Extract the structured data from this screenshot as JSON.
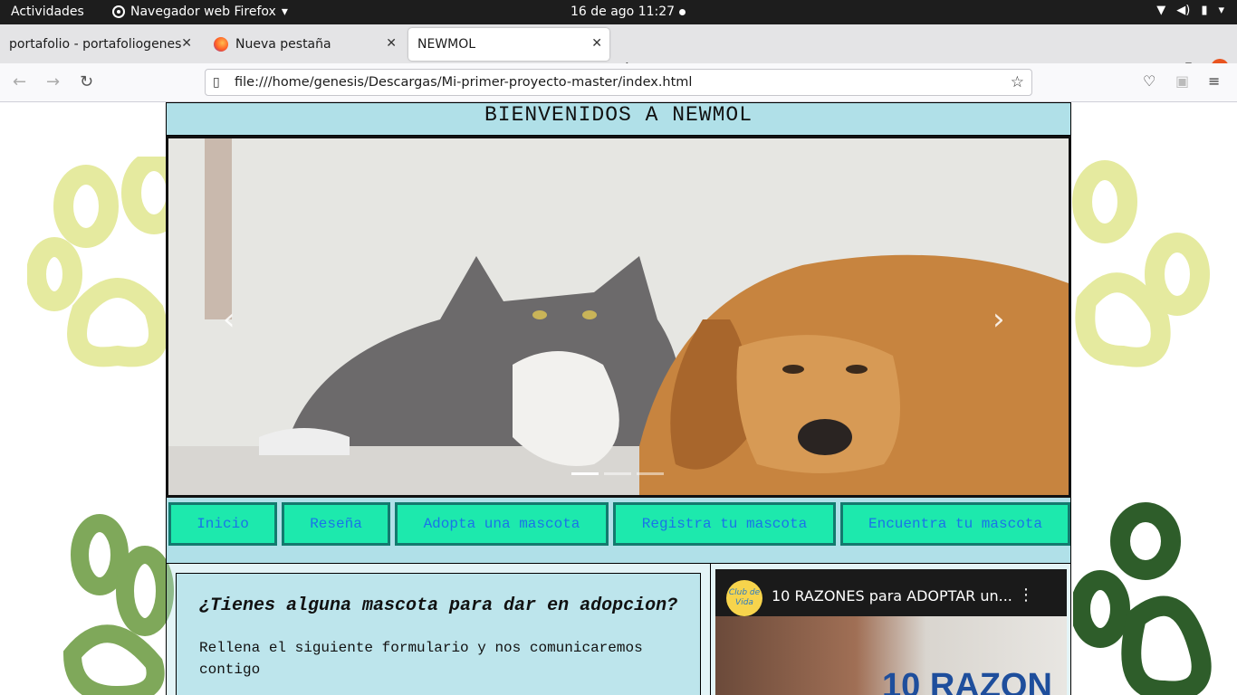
{
  "system_bar": {
    "activities": "Actividades",
    "app_name": "Navegador web Firefox",
    "clock": "16 de ago  11:27"
  },
  "tabs": [
    {
      "label": "portafolio - portafoliogenesi",
      "active": false
    },
    {
      "label": "Nueva pestaña",
      "active": false
    },
    {
      "label": "NEWMOL",
      "active": true
    }
  ],
  "toolbar": {
    "url": "file:///home/genesis/Descargas/Mi-primer-proyecto-master/index.html"
  },
  "site": {
    "header_title": "BIENVENIDOS A NEWMOL",
    "carousel": {
      "slides": 3,
      "active_slide": 1,
      "prev": "‹",
      "next": "›"
    },
    "menu": [
      {
        "label": "Inicio"
      },
      {
        "label": "Reseña"
      },
      {
        "label": "Adopta una mascota"
      },
      {
        "label": "Registra tu mascota"
      },
      {
        "label": "Encuentra tu mascota"
      }
    ],
    "form_section": {
      "heading": "¿Tienes alguna mascota para dar en adopcion?",
      "text": "Rellena el siguiente formulario y nos comunicaremos contigo"
    },
    "video": {
      "channel_logo_text": "Club de Vida",
      "title": "10 RAZONES para ADOPTAR un...",
      "thumbnail_text": "10 RAZON"
    }
  },
  "colors": {
    "header_bg": "#b0e0e8",
    "menu_button_bg": "#1de9ad",
    "menu_button_text": "#1a73e8",
    "topbar_bg": "#1d1d1d"
  }
}
